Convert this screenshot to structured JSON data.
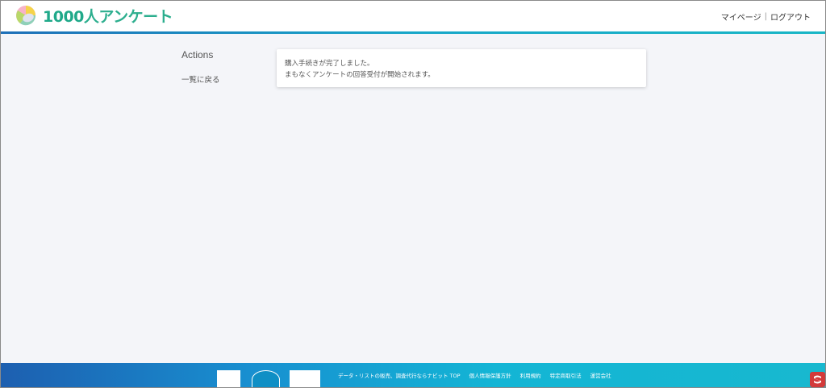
{
  "header": {
    "logo_number": "1000",
    "logo_text": "人アンケート",
    "nav": {
      "mypage": "マイページ",
      "separator": "|",
      "logout": "ログアウト"
    }
  },
  "sidebar": {
    "title": "Actions",
    "back_link": "一覧に戻る"
  },
  "message": {
    "line1": "購入手続きが完了しました。",
    "line2": "まもなくアンケートの回答受付が開始されます。"
  },
  "footer": {
    "links": [
      "データ・リストの販売、調査代行ならナビット TOP",
      "個人情報保護方針",
      "利用規約",
      "特定商取引法",
      "運営会社"
    ]
  },
  "colors": {
    "accent": "#17a7c9",
    "logo_green": "#2cae8e",
    "footer_start": "#1d5fb0",
    "footer_end": "#18b8cf"
  }
}
